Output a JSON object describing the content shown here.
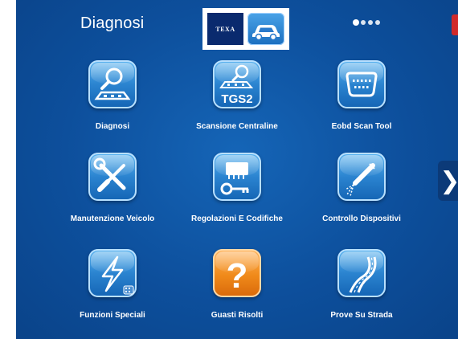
{
  "header": {
    "title": "Diagnosi",
    "logo_text": "TEXA",
    "vehicle_icon": "car-icon",
    "page_dots": [
      true,
      false,
      false,
      false
    ]
  },
  "navigation": {
    "next_icon": "chevron-right-icon",
    "next_glyph": "❯"
  },
  "tiles": [
    {
      "label": "Diagnosi",
      "icon": "magnifier-car-icon"
    },
    {
      "label": "Scansione Centraline",
      "icon": "tgs2-scan-icon",
      "badge": "TGS2"
    },
    {
      "label": "Eobd Scan Tool",
      "icon": "obd-connector-icon"
    },
    {
      "label": "Manutenzione Veicolo",
      "icon": "wrench-screwdriver-icon"
    },
    {
      "label": "Regolazioni E Codifiche",
      "icon": "chip-key-icon"
    },
    {
      "label": "Controllo Dispositivi",
      "icon": "spray-injector-icon"
    },
    {
      "label": "Funzioni Speciali",
      "icon": "lightning-icon"
    },
    {
      "label": "Guasti Risolti",
      "icon": "question-icon",
      "glyph": "?"
    },
    {
      "label": "Prove Su Strada",
      "icon": "road-icon"
    }
  ],
  "colors": {
    "background": "#0d4f9c",
    "tile_blue": "#2b84d0",
    "tile_orange": "#f08a1a",
    "close_red": "#d12a2a"
  }
}
